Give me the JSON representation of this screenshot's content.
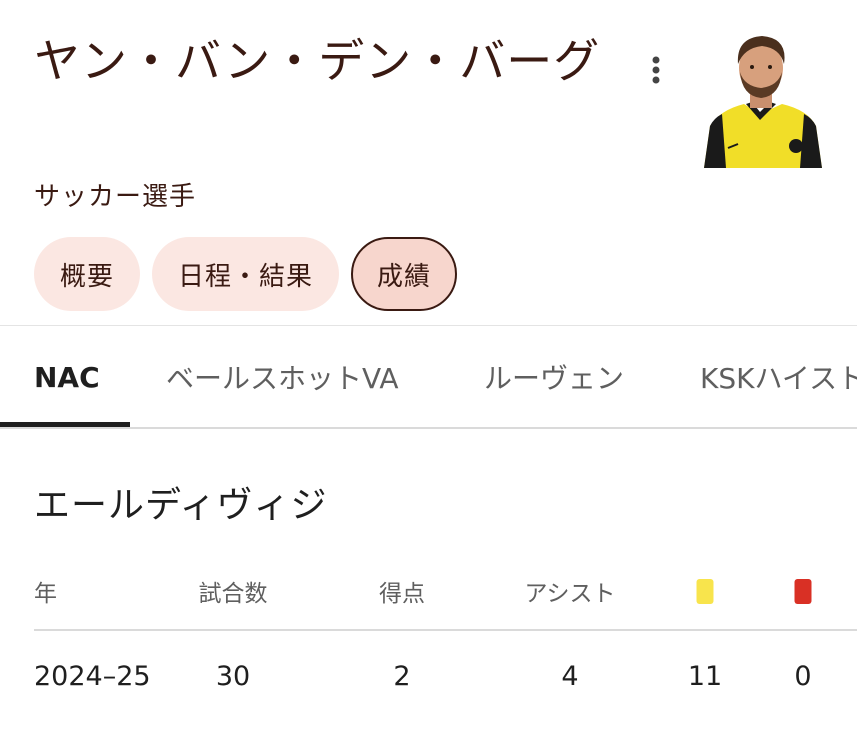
{
  "header": {
    "title": "ヤン・バン・デン・バーグ",
    "subtitle": "サッカー選手",
    "more_icon": "more-vert-icon",
    "avatar_icon": "player-photo"
  },
  "chips": [
    {
      "label": "概要",
      "selected": false
    },
    {
      "label": "日程・結果",
      "selected": false
    },
    {
      "label": "成績",
      "selected": true
    }
  ],
  "team_tabs": [
    {
      "label": "NAC",
      "selected": true
    },
    {
      "label": "ベールスホットVA",
      "selected": false
    },
    {
      "label": "ルーヴェン",
      "selected": false
    },
    {
      "label": "KSKハイスト",
      "selected": false
    }
  ],
  "stats": {
    "competition": "エールディヴィジ",
    "columns": {
      "year": "年",
      "matches": "試合数",
      "goals": "得点",
      "assists": "アシスト",
      "yellow_card_icon": "yellow-card-icon",
      "red_card_icon": "red-card-icon"
    },
    "rows": [
      {
        "year": "2024–25",
        "matches": "30",
        "goals": "2",
        "assists": "4",
        "yellow": "11",
        "red": "0"
      }
    ]
  },
  "colors": {
    "yellow_card": "#f8e44c",
    "red_card": "#d93025",
    "chip_bg": "#fbe7e2",
    "chip_selected_bg": "#f7d6cd",
    "title_text": "#3a1a12"
  }
}
